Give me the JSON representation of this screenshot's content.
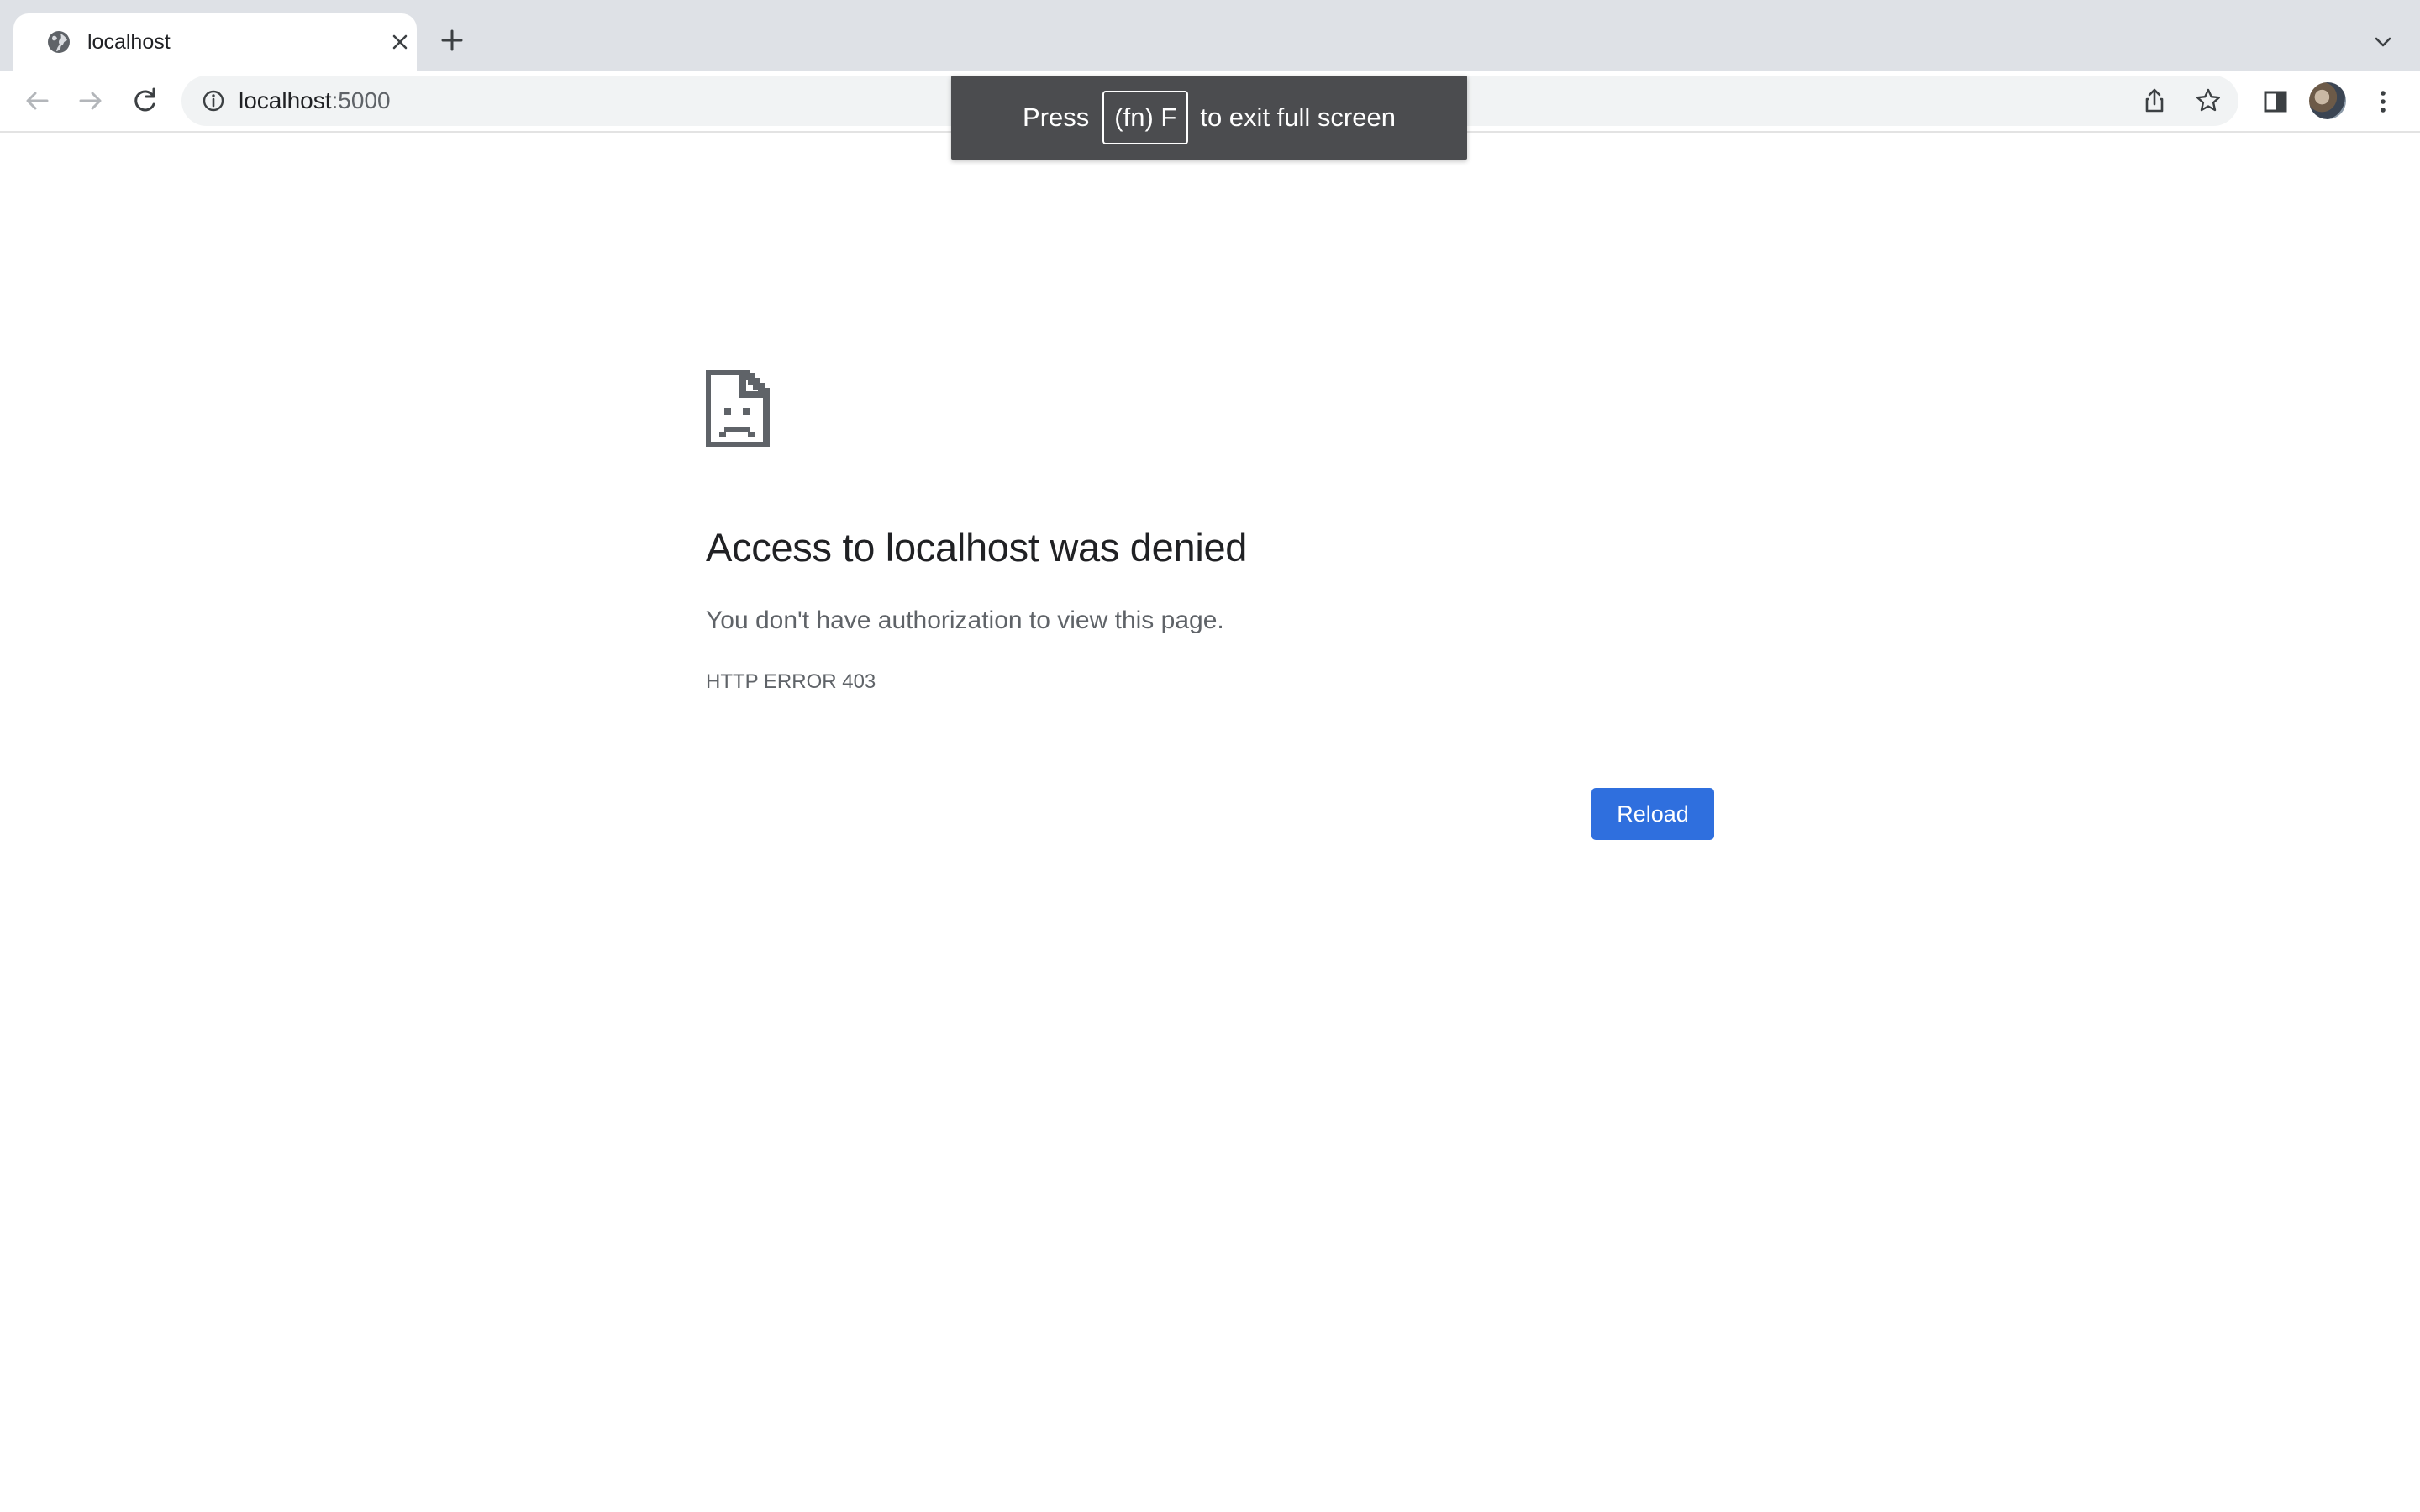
{
  "browser": {
    "tab": {
      "title": "localhost",
      "favicon": "globe-icon",
      "close_icon": "close-icon"
    },
    "new_tab_icon": "plus-icon",
    "tab_search_icon": "chevron-down-icon",
    "toolbar": {
      "back_icon": "arrow-left-icon",
      "forward_icon": "arrow-right-icon",
      "reload_icon": "reload-icon",
      "omnibox": {
        "info_icon": "info-icon",
        "host": "localhost",
        "port": ":5000",
        "share_icon": "share-icon",
        "bookmark_icon": "star-icon"
      },
      "side_panel_icon": "side-panel-icon",
      "profile_icon": "avatar",
      "menu_icon": "kebab-menu-icon"
    }
  },
  "fullscreen_toast": {
    "prefix": "Press",
    "key": "(fn) F",
    "suffix": "to exit full screen"
  },
  "error_page": {
    "icon": "sad-document-icon",
    "heading": "Access to localhost was denied",
    "message": "You don't have authorization to view this page.",
    "error_code": "HTTP ERROR 403",
    "reload_label": "Reload",
    "accent_color": "#2f6fde"
  }
}
